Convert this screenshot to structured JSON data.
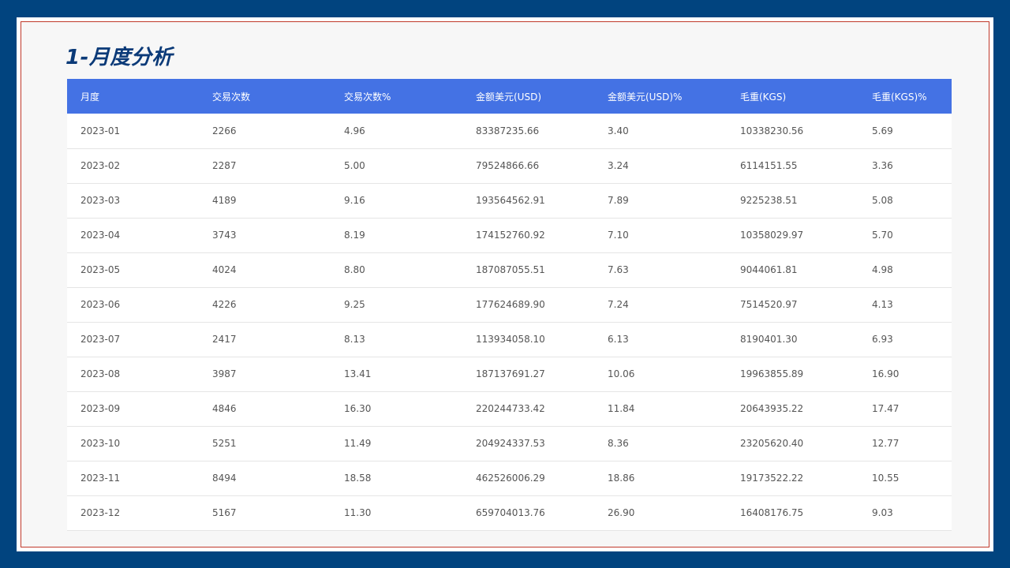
{
  "page": {
    "title": "1-月度分析"
  },
  "table": {
    "headers": [
      "月度",
      "交易次数",
      "交易次数%",
      "金额美元(USD)",
      "金额美元(USD)%",
      "毛重(KGS)",
      "毛重(KGS)%"
    ],
    "rows": [
      [
        "2023-01",
        "2266",
        "4.96",
        "83387235.66",
        "3.40",
        "10338230.56",
        "5.69"
      ],
      [
        "2023-02",
        "2287",
        "5.00",
        "79524866.66",
        "3.24",
        "6114151.55",
        "3.36"
      ],
      [
        "2023-03",
        "4189",
        "9.16",
        "193564562.91",
        "7.89",
        "9225238.51",
        "5.08"
      ],
      [
        "2023-04",
        "3743",
        "8.19",
        "174152760.92",
        "7.10",
        "10358029.97",
        "5.70"
      ],
      [
        "2023-05",
        "4024",
        "8.80",
        "187087055.51",
        "7.63",
        "9044061.81",
        "4.98"
      ],
      [
        "2023-06",
        "4226",
        "9.25",
        "177624689.90",
        "7.24",
        "7514520.97",
        "4.13"
      ],
      [
        "2023-07",
        "2417",
        "8.13",
        "113934058.10",
        "6.13",
        "8190401.30",
        "6.93"
      ],
      [
        "2023-08",
        "3987",
        "13.41",
        "187137691.27",
        "10.06",
        "19963855.89",
        "16.90"
      ],
      [
        "2023-09",
        "4846",
        "16.30",
        "220244733.42",
        "11.84",
        "20643935.22",
        "17.47"
      ],
      [
        "2023-10",
        "5251",
        "11.49",
        "204924337.53",
        "8.36",
        "23205620.40",
        "12.77"
      ],
      [
        "2023-11",
        "8494",
        "18.58",
        "462526006.29",
        "18.86",
        "19173522.22",
        "10.55"
      ],
      [
        "2023-12",
        "5167",
        "11.30",
        "659704013.76",
        "26.90",
        "16408176.75",
        "9.03"
      ]
    ]
  },
  "colors": {
    "background": "#01447f",
    "title": "#0b3a78",
    "header": "#4472e4",
    "frame_border": "#c0392b"
  }
}
